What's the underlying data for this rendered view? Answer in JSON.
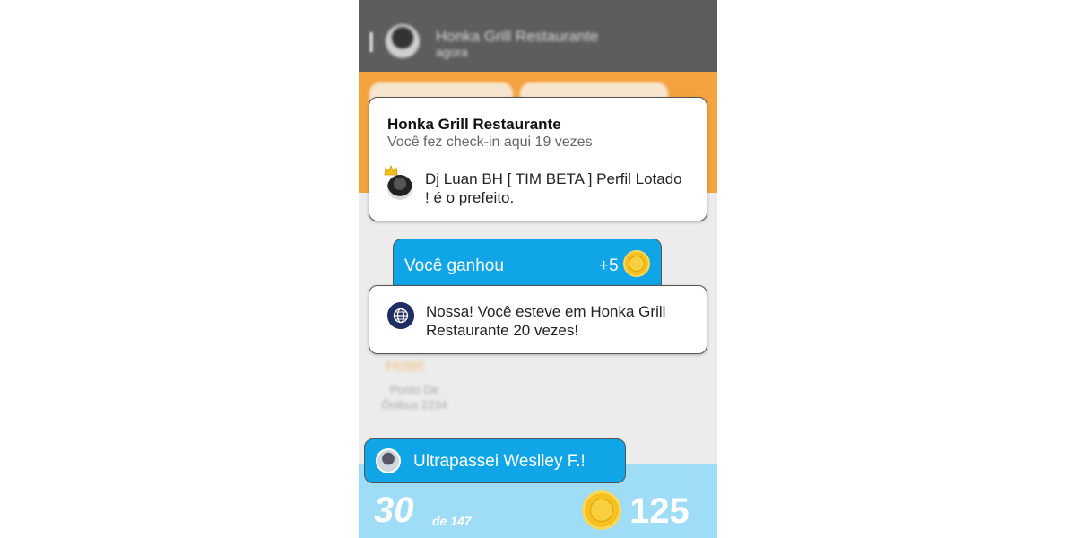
{
  "background": {
    "header_title": "Honka Grill Restaurante",
    "header_time": "agora",
    "hotel_label": "Hotel",
    "place_label": "Ponto De Ônibus 2234"
  },
  "checkin_card": {
    "venue_name": "Honka Grill Restaurante",
    "checkin_count_text": "Você fez check-in aqui 19 vezes",
    "mayor_text": "Dj Luan BH [ TIM BETA ] Perfil Lotado ! é o prefeito."
  },
  "earned_card": {
    "label": "Você ganhou",
    "amount": "+5"
  },
  "message_card": {
    "text": "Nossa! Você esteve em Honka Grill Restaurante 20 vezes!"
  },
  "toast": {
    "text": "Ultrapassei Weslley F.!"
  },
  "footer": {
    "rank": "30",
    "rank_of": "de 147",
    "coins": "125"
  },
  "colors": {
    "header_bg": "#5d5d5d",
    "orange": "#f4a340",
    "blue": "#0fa5e6",
    "cloud": "#9fdcf5",
    "coin": "#f5c020"
  }
}
